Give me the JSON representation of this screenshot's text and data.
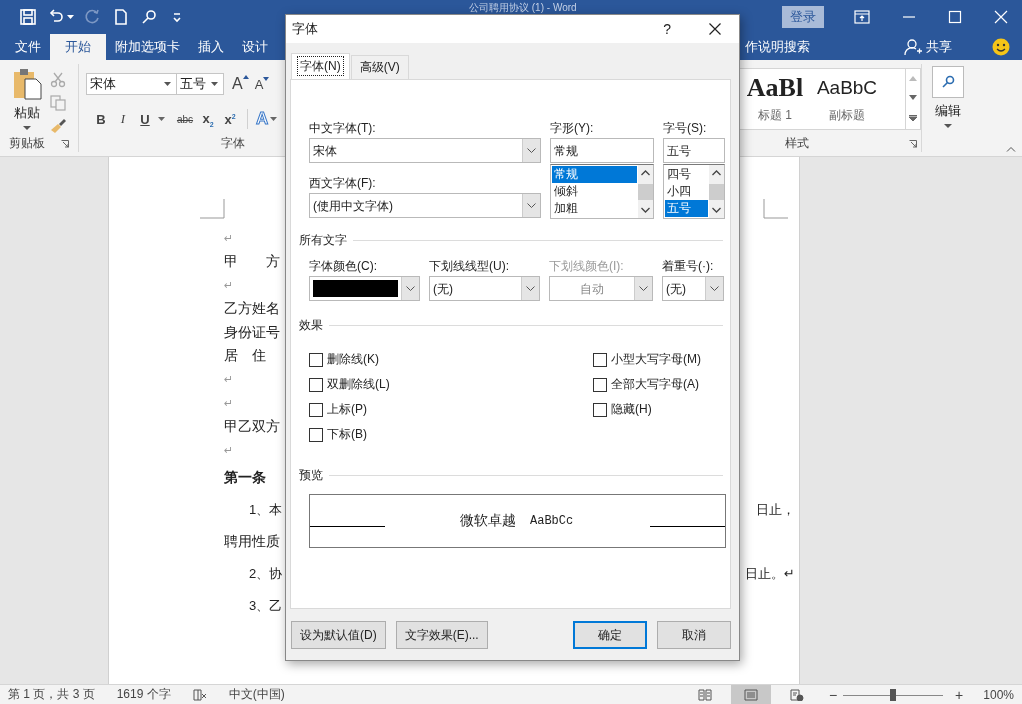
{
  "window": {
    "title": "公司聘用协议 (1)  -  Word",
    "sign_in": "登录"
  },
  "quick_access": [
    {
      "kind": "save",
      "disabled": false
    },
    {
      "kind": "undo",
      "disabled": false
    },
    {
      "kind": "redo",
      "disabled": true
    },
    {
      "kind": "new",
      "disabled": false
    },
    {
      "kind": "search",
      "disabled": false
    },
    {
      "kind": "customize",
      "disabled": false
    }
  ],
  "ribbon_tabs": [
    {
      "label": "文件",
      "selected": false
    },
    {
      "label": "开始",
      "selected": true
    },
    {
      "label": "附加选项卡",
      "selected": false
    },
    {
      "label": "插入",
      "selected": false
    },
    {
      "label": "设计",
      "selected": false
    }
  ],
  "tell_me": "作说明搜索",
  "share": "共享",
  "ribbon": {
    "clipboard": {
      "paste": "粘贴",
      "label": "剪贴板"
    },
    "font": {
      "font_name": "宋体",
      "font_size": "五号",
      "grow": "A",
      "shrink": "A",
      "format_buttons": [
        {
          "kind": "bold",
          "label": "B"
        },
        {
          "kind": "italic",
          "label": "I"
        },
        {
          "kind": "underline",
          "label": "U"
        },
        {
          "kind": "strike",
          "label": "abc"
        },
        {
          "kind": "sub",
          "label": "x$_{2}$"
        },
        {
          "kind": "sup",
          "label": "x$^{2}$"
        }
      ],
      "effects": "A",
      "label": "字体"
    },
    "styles": {
      "items": [
        {
          "preview": "AaBl",
          "name": "标题 1",
          "kind": "heading"
        },
        {
          "preview": "AaBbC",
          "name": "副标题",
          "kind": "subtitle"
        }
      ],
      "label": "样式"
    },
    "editing": {
      "label": "编辑"
    }
  },
  "document": {
    "lines": [
      {
        "kind": "mark",
        "text": "↵"
      },
      {
        "kind": "line",
        "text": "甲　　方"
      },
      {
        "kind": "mark",
        "text": "↵"
      },
      {
        "kind": "line",
        "text": "乙方姓名"
      },
      {
        "kind": "line",
        "text": "身份证号"
      },
      {
        "kind": "line",
        "text": "居　住"
      },
      {
        "kind": "mark",
        "text": "↵"
      },
      {
        "kind": "mark",
        "text": "↵"
      },
      {
        "kind": "line",
        "text": "甲乙双方"
      },
      {
        "kind": "mark",
        "text": "↵"
      },
      {
        "kind": "heading",
        "text": "第一条"
      },
      {
        "kind": "clause",
        "indent": true,
        "text": "1、本",
        "tail": "日止，"
      },
      {
        "kind": "clause",
        "indent": false,
        "text": "聘用性质"
      },
      {
        "kind": "clause",
        "indent": true,
        "text": "2、协",
        "tail": "日止。↵"
      },
      {
        "kind": "clause",
        "indent": true,
        "text": "3、乙"
      }
    ]
  },
  "dialog": {
    "title": "字体",
    "help": "?",
    "tabs": [
      {
        "label": "字体(N)",
        "selected": true
      },
      {
        "label": "高级(V)",
        "selected": false
      }
    ],
    "chinese_font": {
      "label": "中文字体(T):",
      "value": "宋体"
    },
    "western_font": {
      "label": "西文字体(F):",
      "value": "(使用中文字体)"
    },
    "style": {
      "label": "字形(Y):",
      "value": "常规",
      "options": [
        {
          "label": "常规",
          "selected": true
        },
        {
          "label": "倾斜",
          "selected": false
        },
        {
          "label": "加粗",
          "selected": false
        }
      ]
    },
    "size": {
      "label": "字号(S):",
      "value": "五号",
      "options": [
        {
          "label": "四号",
          "selected": false
        },
        {
          "label": "小四",
          "selected": false
        },
        {
          "label": "五号",
          "selected": true
        }
      ]
    },
    "all_text_heading": "所有文字",
    "combos": [
      {
        "kind": "color",
        "label": "字体颜色(C):",
        "disabled": false
      },
      {
        "kind": "text",
        "label": "下划线线型(U):",
        "value": "(无)",
        "disabled": false
      },
      {
        "kind": "text",
        "label": "下划线颜色(I):",
        "value": "自动",
        "disabled": true
      },
      {
        "kind": "text",
        "label": "着重号(·):",
        "value": "(无)",
        "disabled": false
      }
    ],
    "effects_heading": "效果",
    "effects": [
      {
        "label": "删除线(K)",
        "checked": false
      },
      {
        "label": "双删除线(L)",
        "checked": false
      },
      {
        "label": "上标(P)",
        "checked": false
      },
      {
        "label": "下标(B)",
        "checked": false
      },
      {
        "label": "小型大写字母(M)",
        "checked": false
      },
      {
        "label": "全部大写字母(A)",
        "checked": false
      },
      {
        "label": "隐藏(H)",
        "checked": false
      }
    ],
    "preview_heading": "预览",
    "preview_text": "微软卓越",
    "preview_latin": "AaBbCc",
    "buttons": [
      {
        "label": "设为默认值(D)",
        "focused": false
      },
      {
        "label": "文字效果(E)...",
        "focused": false
      },
      {
        "label": "确定",
        "focused": true
      },
      {
        "label": "取消",
        "focused": false
      }
    ]
  },
  "status_bar": {
    "page": "第 1 页，共 3 页",
    "words": "1619 个字",
    "language": "中文(中国)",
    "views": [
      {
        "kind": "read",
        "selected": false
      },
      {
        "kind": "print",
        "selected": true
      },
      {
        "kind": "web",
        "selected": false
      }
    ],
    "zoom": {
      "minus": "−",
      "level": 0.5,
      "plus": "+",
      "reading": "100%"
    }
  }
}
